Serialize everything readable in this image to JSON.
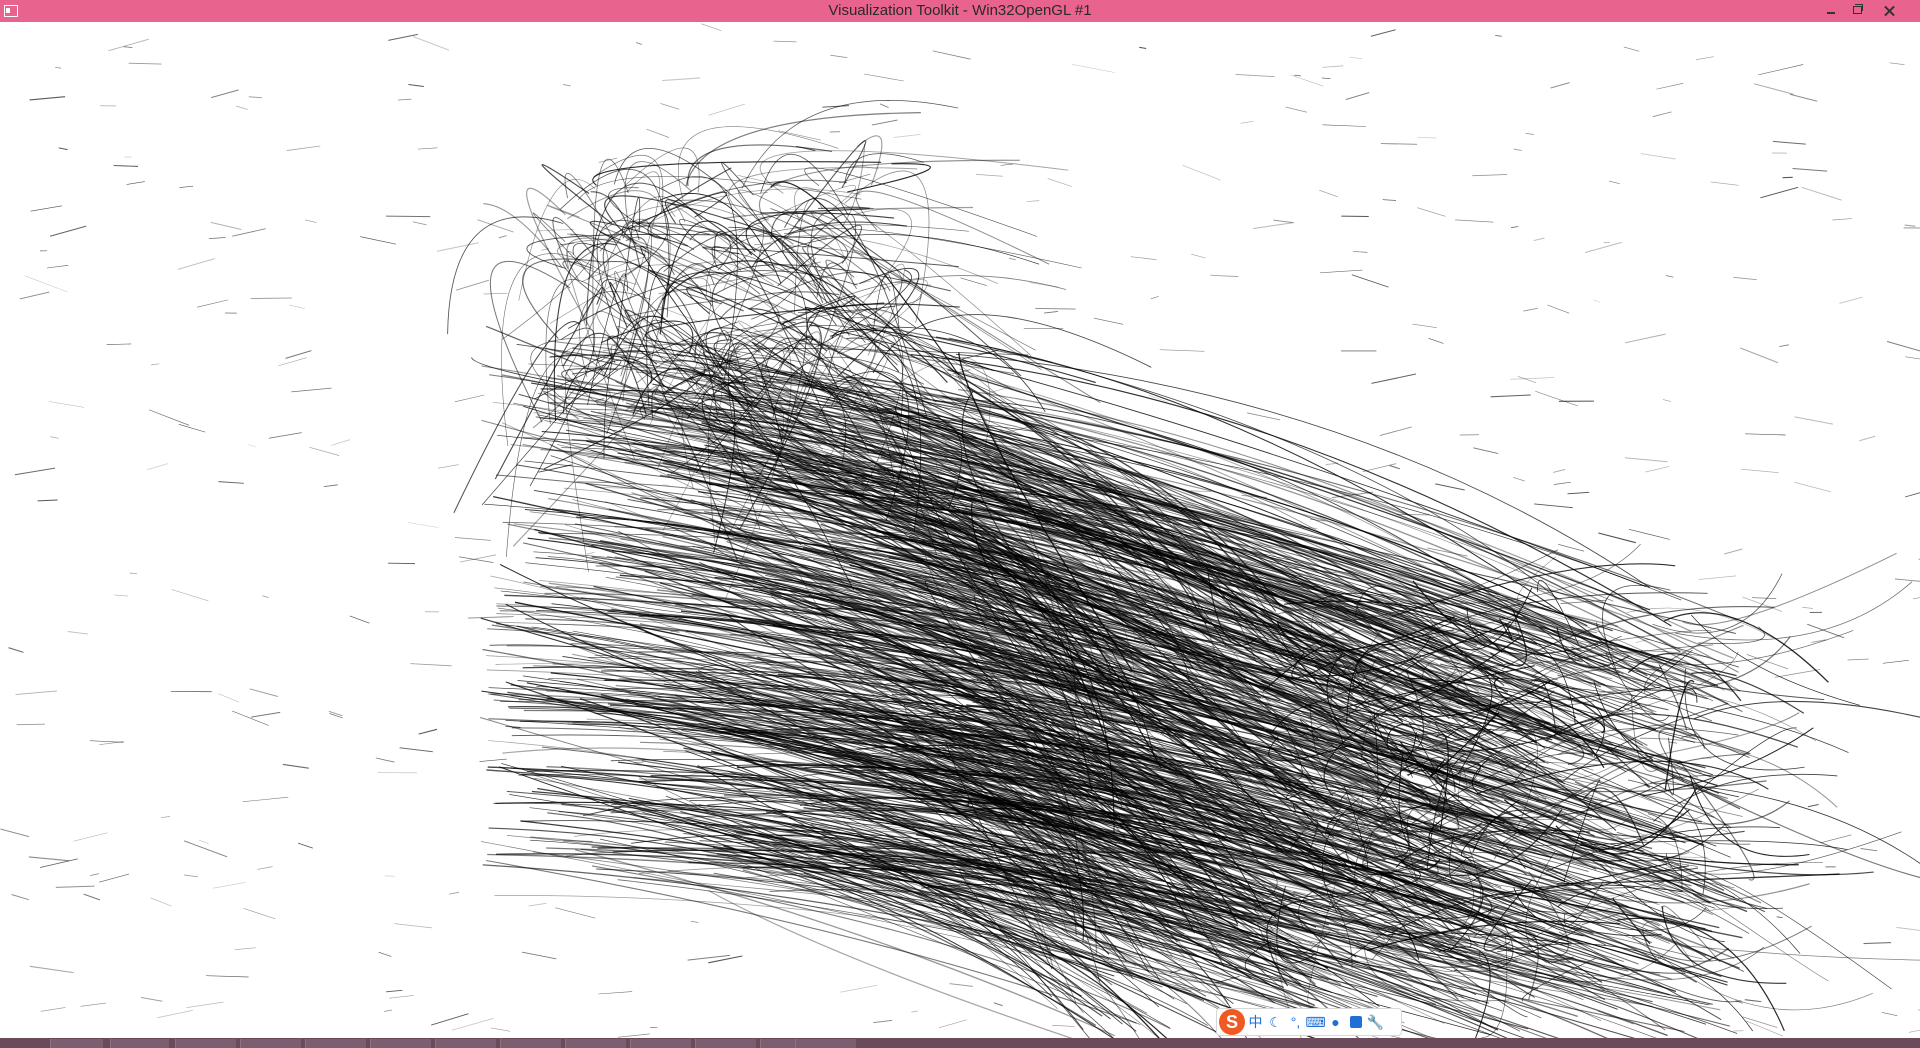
{
  "window": {
    "title": "Visualization Toolkit - Win32OpenGL #1",
    "titlebar_color": "#e8648e"
  },
  "window_controls": [
    "minimize-icon",
    "restore-icon",
    "close-icon"
  ],
  "render_view": {
    "background": "#ffffff",
    "content": "streamline-lines",
    "line_color": "#000000"
  },
  "ime_toolbar": {
    "logo": "S",
    "mode_label": "中",
    "icons": [
      "ime-logo-icon",
      "moon-icon",
      "punctuation-icon",
      "keyboard-icon",
      "user-icon",
      "shirt-icon",
      "wrench-icon"
    ]
  },
  "taskbar": {
    "color": "#6b4a5c"
  }
}
